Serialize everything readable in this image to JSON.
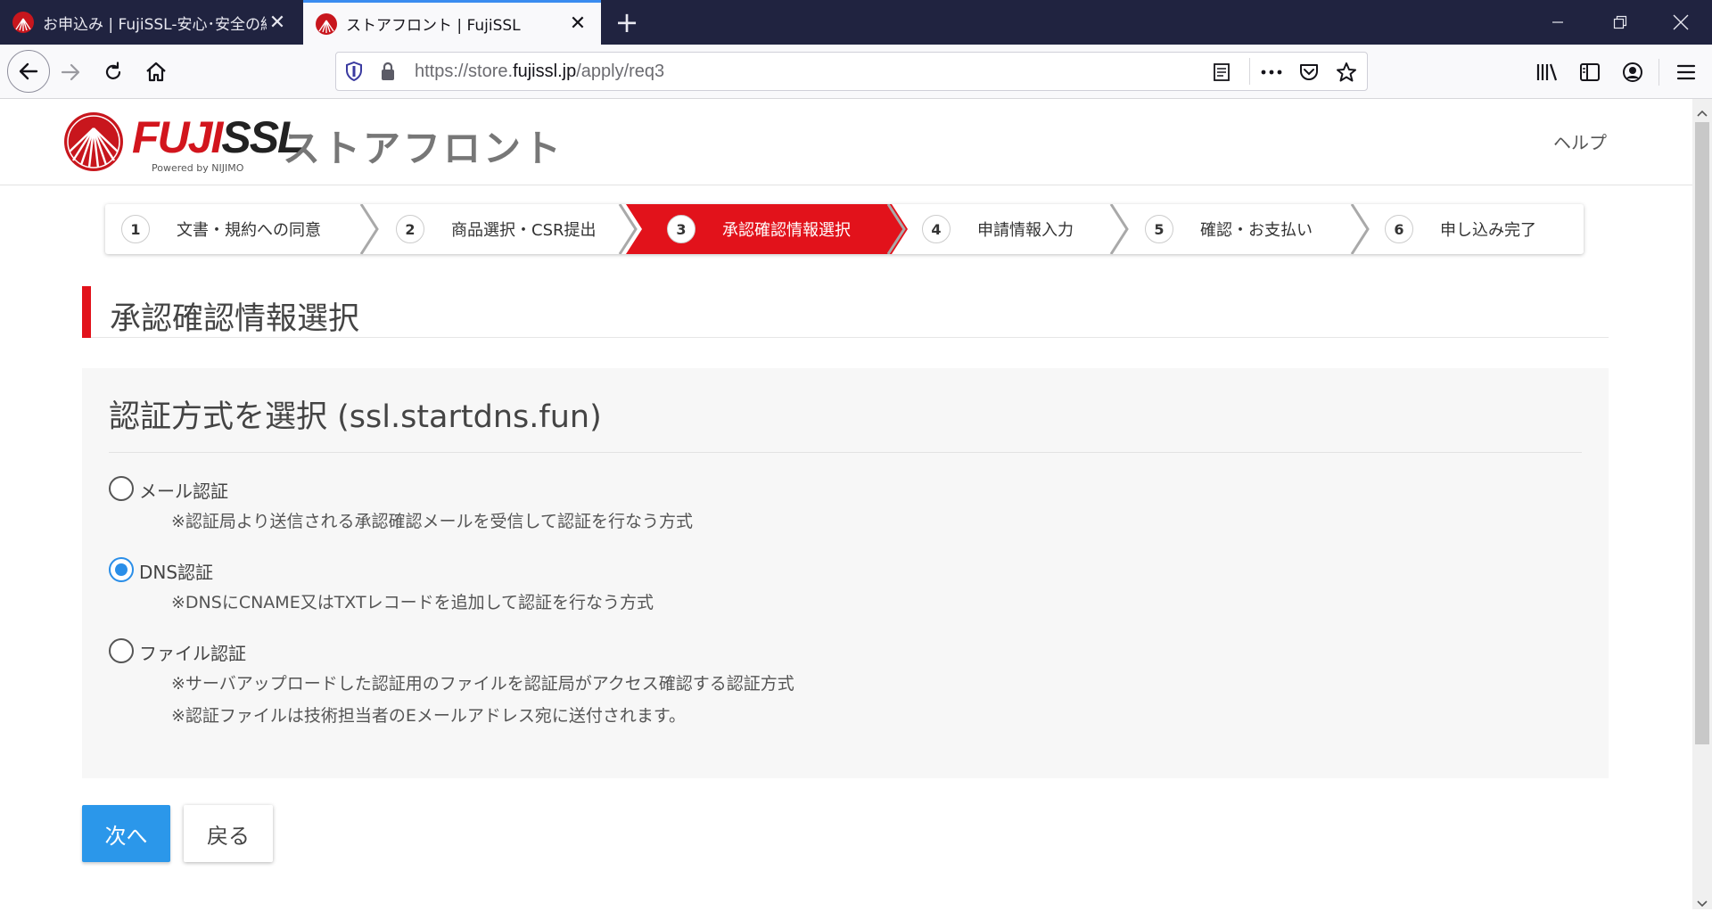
{
  "browser": {
    "tabs": [
      {
        "title": "お申込み | FujiSSL-安心･安全の純",
        "active": false
      },
      {
        "title": "ストアフロント | FujiSSL",
        "active": true
      }
    ],
    "url_prefix": "https://store.",
    "url_domain": "fujissl.jp",
    "url_path": "/apply/req3"
  },
  "header": {
    "logo_main": "FUJI",
    "logo_ssl": "SSL",
    "logo_sub": "Powered by NIJIMO",
    "store_title": "ストアフロント",
    "help": "ヘルプ"
  },
  "steps": [
    {
      "num": "1",
      "label": "文書・規約への同意"
    },
    {
      "num": "2",
      "label": "商品選択・CSR提出"
    },
    {
      "num": "3",
      "label": "承認確認情報選択"
    },
    {
      "num": "4",
      "label": "申請情報入力"
    },
    {
      "num": "5",
      "label": "確認・お支払い"
    },
    {
      "num": "6",
      "label": "申し込み完了"
    }
  ],
  "active_step": 3,
  "colors": {
    "accent": "#e2121b",
    "primary_button": "#2b97ea",
    "radio_checked": "#2a8ee8"
  },
  "section_title": "承認確認情報選択",
  "panel_title": "認証方式を選択 (ssl.startdns.fun)",
  "options": [
    {
      "label": "メール認証",
      "notes": [
        "※認証局より送信される承認確認メールを受信して認証を行なう方式"
      ],
      "checked": false
    },
    {
      "label": "DNS認証",
      "notes": [
        "※DNSにCNAME又はTXTレコードを追加して認証を行なう方式"
      ],
      "checked": true
    },
    {
      "label": "ファイル認証",
      "notes": [
        "※サーバアップロードした認証用のファイルを認証局がアクセス確認する認証方式",
        "※認証ファイルは技術担当者のEメールアドレス宛に送付されます。"
      ],
      "checked": false
    }
  ],
  "buttons": {
    "next": "次へ",
    "back": "戻る"
  }
}
